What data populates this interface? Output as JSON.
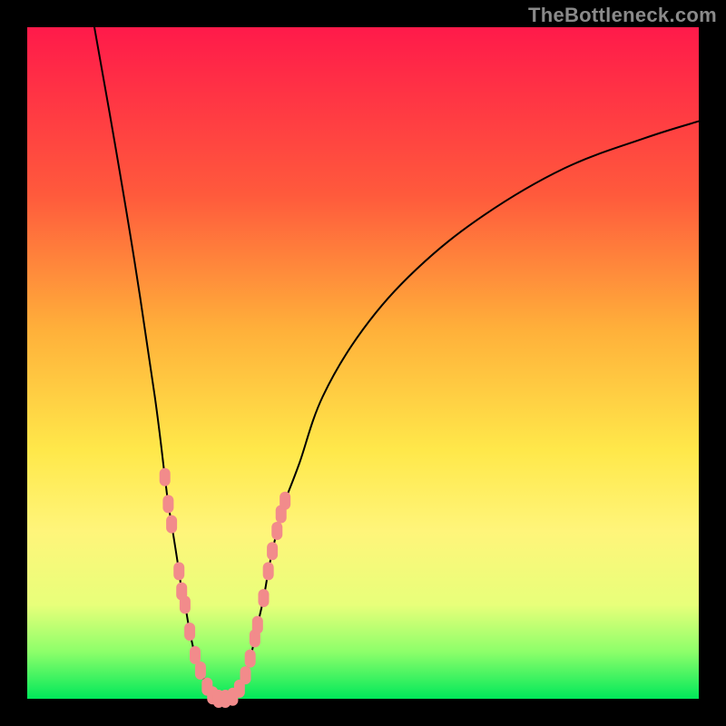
{
  "watermark": "TheBottleneck.com",
  "colors": {
    "gradient_top": "#ff1a4a",
    "gradient_bottom": "#00e85a",
    "curve_stroke": "#000000",
    "marker_fill": "#f28b8b",
    "frame": "#000000"
  },
  "chart_data": {
    "type": "line",
    "title": "",
    "xlabel": "",
    "ylabel": "",
    "xlim": [
      0,
      100
    ],
    "ylim": [
      0,
      100
    ],
    "data_points": [
      {
        "x": 10,
        "y": 100
      },
      {
        "x": 13,
        "y": 83
      },
      {
        "x": 16,
        "y": 65
      },
      {
        "x": 19,
        "y": 45
      },
      {
        "x": 20.5,
        "y": 33
      },
      {
        "x": 21.0,
        "y": 29
      },
      {
        "x": 21.5,
        "y": 26
      },
      {
        "x": 22.6,
        "y": 19
      },
      {
        "x": 23.0,
        "y": 16
      },
      {
        "x": 23.5,
        "y": 14
      },
      {
        "x": 24.2,
        "y": 10
      },
      {
        "x": 25.0,
        "y": 6.5
      },
      {
        "x": 25.8,
        "y": 4.2
      },
      {
        "x": 26.8,
        "y": 1.8
      },
      {
        "x": 27.6,
        "y": 0.5
      },
      {
        "x": 28.5,
        "y": 0
      },
      {
        "x": 29.5,
        "y": 0
      },
      {
        "x": 30.6,
        "y": 0.3
      },
      {
        "x": 31.6,
        "y": 1.5
      },
      {
        "x": 32.5,
        "y": 3.5
      },
      {
        "x": 33.2,
        "y": 6.0
      },
      {
        "x": 33.9,
        "y": 9.0
      },
      {
        "x": 34.3,
        "y": 11
      },
      {
        "x": 35.2,
        "y": 15
      },
      {
        "x": 35.9,
        "y": 19
      },
      {
        "x": 36.5,
        "y": 22
      },
      {
        "x": 37.2,
        "y": 25
      },
      {
        "x": 37.8,
        "y": 27.5
      },
      {
        "x": 38.4,
        "y": 29.5
      },
      {
        "x": 40.5,
        "y": 35
      },
      {
        "x": 44,
        "y": 45
      },
      {
        "x": 50,
        "y": 55
      },
      {
        "x": 58,
        "y": 64
      },
      {
        "x": 68,
        "y": 72
      },
      {
        "x": 80,
        "y": 79
      },
      {
        "x": 92,
        "y": 83.5
      },
      {
        "x": 100,
        "y": 86
      }
    ],
    "marker_indices": [
      4,
      5,
      6,
      7,
      8,
      9,
      10,
      11,
      12,
      13,
      14,
      15,
      16,
      17,
      18,
      19,
      20,
      21,
      22,
      23,
      24,
      25,
      26,
      27,
      28
    ]
  }
}
